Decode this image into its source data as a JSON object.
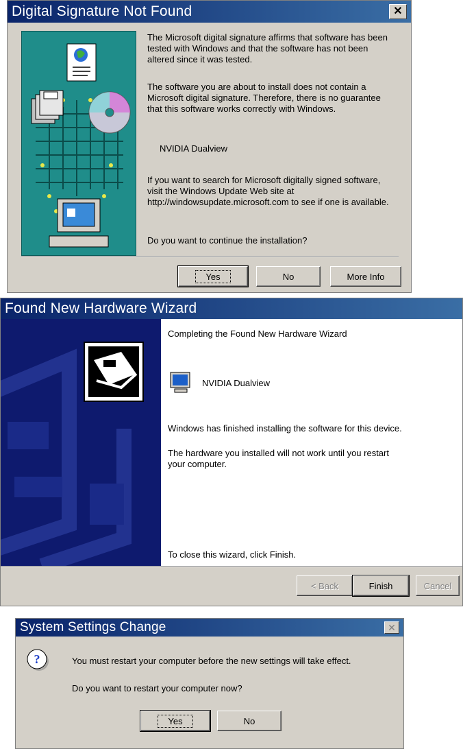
{
  "sig": {
    "title": "Digital Signature Not Found",
    "p1": "The Microsoft digital signature affirms that software has been tested with Windows and that the software has not been altered since it was tested.",
    "p2": "The software you are about to install does not contain a Microsoft digital signature. Therefore,  there is no guarantee that this software works correctly with Windows.",
    "device": "NVIDIA Dualview",
    "p3": "If you want to search for Microsoft digitally signed software, visit the Windows Update Web site at http://windowsupdate.microsoft.com to see if one is available.",
    "question": "Do you want to continue the installation?",
    "yes_label": "Yes",
    "no_label": "No",
    "more_info_label": "More Info"
  },
  "wizard": {
    "title": "Found New Hardware Wizard",
    "heading": "Completing the Found New Hardware Wizard",
    "device": "NVIDIA Dualview",
    "p1": "Windows has finished installing the software for this device.",
    "p2": "The hardware you installed will not work until you restart your computer.",
    "close_text": "To close this wizard, click Finish.",
    "back_label": "< Back",
    "finish_label": "Finish",
    "cancel_label": "Cancel"
  },
  "settings": {
    "title": "System Settings Change",
    "message": "You must restart your computer before the new settings will take effect.",
    "question": "Do you want to restart your computer now?",
    "yes_label": "Yes",
    "no_label": "No"
  },
  "colors": {
    "titlebar_start": "#0a246a",
    "titlebar_end": "#3a6ea5",
    "dialog_face": "#d4d0c8",
    "wizard_panel": "#0e1a6e",
    "sig_panel": "#1f8d8a"
  }
}
